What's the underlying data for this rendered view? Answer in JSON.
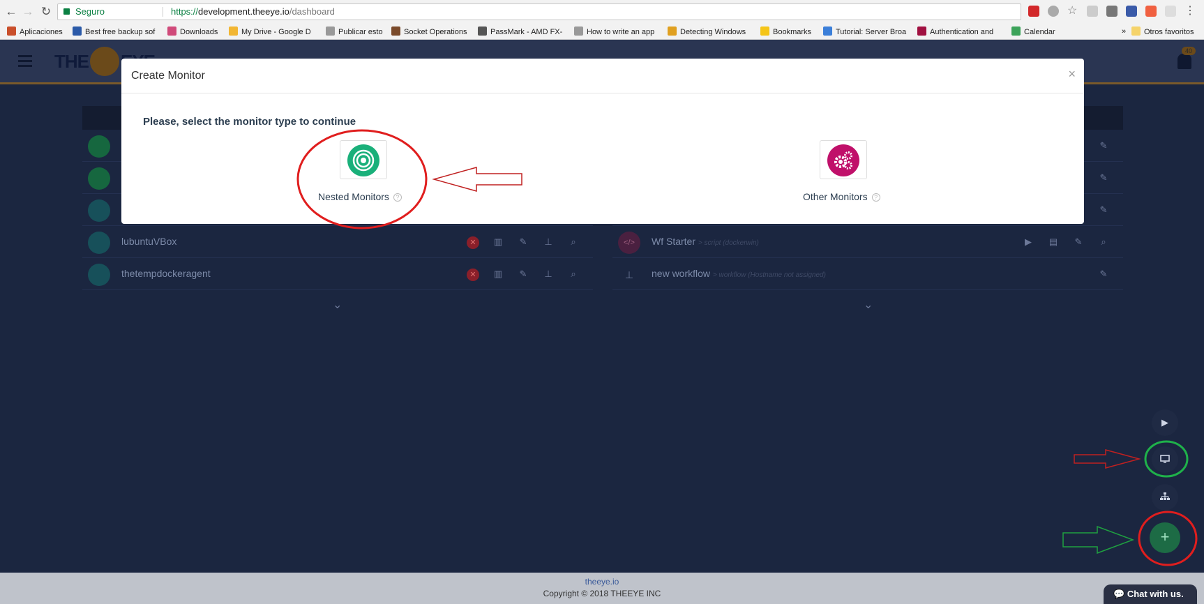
{
  "browser": {
    "secure_label": "Seguro",
    "url_scheme": "https://",
    "url_host": "development.theeye.io",
    "url_path": "/dashboard",
    "bookmarks": [
      {
        "label": "Aplicaciones",
        "color": "#c94f2b"
      },
      {
        "label": "Best free backup sof",
        "color": "#2b5aa8"
      },
      {
        "label": "Downloads",
        "color": "#d04a7a"
      },
      {
        "label": "My Drive - Google D",
        "color": "#f2b632"
      },
      {
        "label": "Publicar esto",
        "color": "#999999"
      },
      {
        "label": "Socket Operations",
        "color": "#7a4a2a"
      },
      {
        "label": "PassMark - AMD FX-",
        "color": "#555555"
      },
      {
        "label": "How to write an app",
        "color": "#999999"
      },
      {
        "label": "Detecting Windows",
        "color": "#e0a020"
      },
      {
        "label": "Bookmarks",
        "color": "#f5c518"
      },
      {
        "label": "Tutorial: Server Broa",
        "color": "#3b7fd9"
      },
      {
        "label": "Authentication and",
        "color": "#a01040"
      },
      {
        "label": "Calendar",
        "color": "#3ca35a"
      }
    ],
    "more_bookmarks": "»",
    "other_favorites": "Otros favoritos"
  },
  "header": {
    "logo_text_left": "THE",
    "logo_text_right": "EYE",
    "notification_count": "40"
  },
  "left_panel": {
    "rows": [
      {
        "name": "",
        "color": "#16673f"
      },
      {
        "name": "",
        "color": "#16673f"
      },
      {
        "name": "",
        "color": "#17505a"
      },
      {
        "name": "lubuntuVBox",
        "color": "#17505a"
      },
      {
        "name": "thetempdockeragent",
        "color": "#17505a"
      }
    ]
  },
  "right_panel": {
    "rows": [
      {
        "name": "",
        "sub": ""
      },
      {
        "name": "",
        "sub": ""
      },
      {
        "name": "",
        "sub": ""
      },
      {
        "name": "Wf Starter",
        "sub": "> script (dockerwin)"
      },
      {
        "name": "new workflow",
        "sub": "> workflow (Hostname not assigned)"
      }
    ]
  },
  "modal": {
    "title": "Create Monitor",
    "close": "×",
    "prompt": "Please, select the monitor type to continue",
    "options": [
      {
        "label": "Nested Monitors",
        "color": "#1ab07a"
      },
      {
        "label": "Other Monitors",
        "color": "#c0106a"
      }
    ]
  },
  "footer": {
    "link": "theeye.io",
    "copyright": "Copyright © 2018 THEEYE INC"
  },
  "chat": {
    "label": "Chat with us."
  }
}
